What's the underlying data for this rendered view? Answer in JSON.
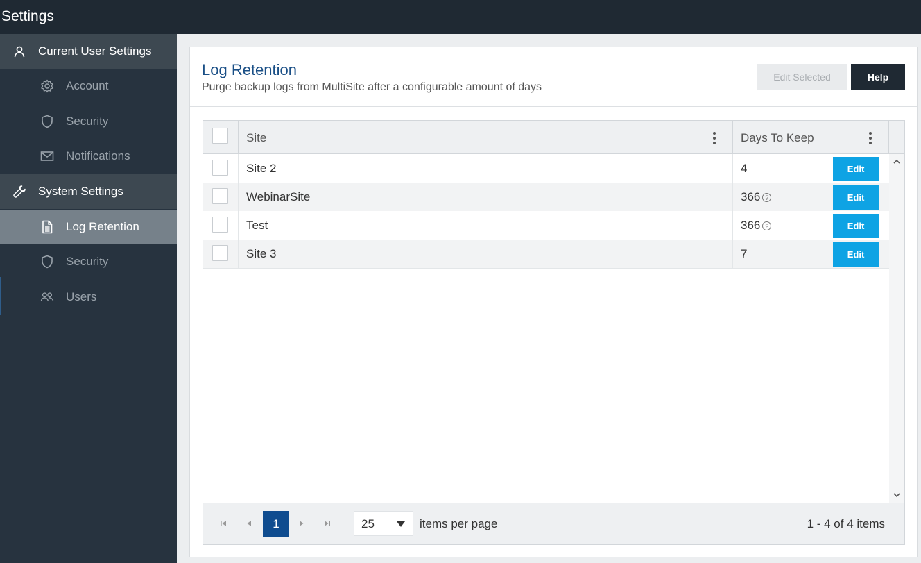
{
  "app": {
    "title": "Settings"
  },
  "sidebar": {
    "sections": [
      {
        "label": "Current User Settings",
        "icon": "user-icon",
        "items": [
          {
            "label": "Account",
            "icon": "gear-icon"
          },
          {
            "label": "Security",
            "icon": "shield-icon"
          },
          {
            "label": "Notifications",
            "icon": "envelope-icon"
          }
        ]
      },
      {
        "label": "System Settings",
        "icon": "wrench-icon",
        "items": [
          {
            "label": "Log Retention",
            "icon": "document-icon",
            "active": true
          },
          {
            "label": "Security",
            "icon": "shield-icon"
          },
          {
            "label": "Users",
            "icon": "users-icon"
          }
        ]
      }
    ]
  },
  "page": {
    "title": "Log Retention",
    "subtitle": "Purge backup logs from MultiSite after a configurable amount of days",
    "edit_selected_label": "Edit Selected",
    "help_label": "Help"
  },
  "grid": {
    "columns": {
      "site": "Site",
      "days": "Days To Keep"
    },
    "edit_label": "Edit",
    "rows": [
      {
        "site": "Site 2",
        "days": "4",
        "has_help": false
      },
      {
        "site": "WebinarSite",
        "days": "366",
        "has_help": true
      },
      {
        "site": "Test",
        "days": "366",
        "has_help": true
      },
      {
        "site": "Site 3",
        "days": "7",
        "has_help": false
      }
    ],
    "help_glyph": "?"
  },
  "pager": {
    "current_page": "1",
    "page_size": "25",
    "per_page_label": "items per page",
    "info": "1 - 4 of 4 items"
  },
  "colors": {
    "topbar": "#1f2933",
    "sidebar": "#27333f",
    "accent_blue": "#0ea3e4",
    "title_blue": "#1a4f86",
    "pager_current": "#0f4c8f"
  }
}
